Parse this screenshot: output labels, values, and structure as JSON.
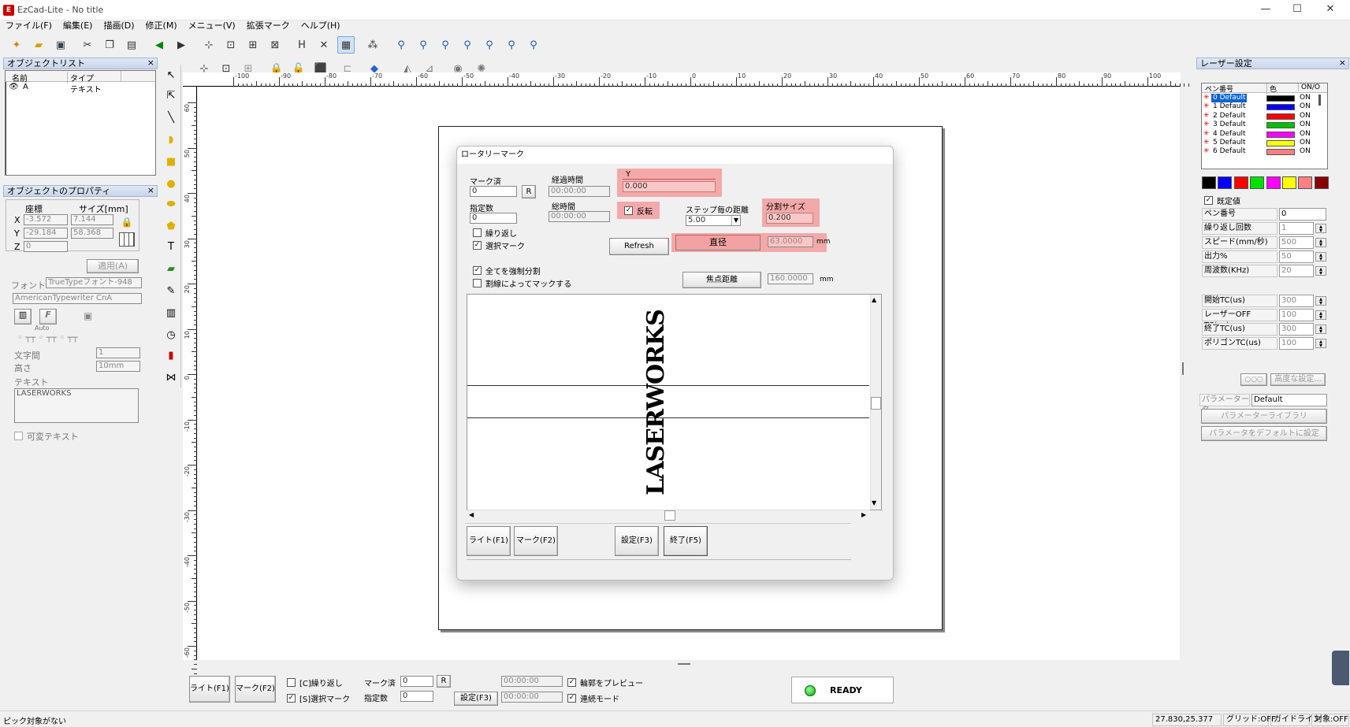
{
  "app": {
    "title": "EzCad-Lite  - No title",
    "icon": "ezcad-logo-icon"
  },
  "window_controls": {
    "minimize": "—",
    "maximize": "☐",
    "close": "✕"
  },
  "menu": [
    "ファイル(F)",
    "編集(E)",
    "描画(D)",
    "修正(M)",
    "メニュー(V)",
    "拡張マーク",
    "ヘルプ(H)"
  ],
  "object_list": {
    "title": "オブジェクトリスト",
    "col_name": "名前",
    "col_type": "タイプ",
    "rows": [
      {
        "name": "A",
        "type": "テキスト"
      }
    ]
  },
  "object_props": {
    "title": "オブジェクトのプロパティ",
    "coord_label": "座標",
    "size_label": "サイズ[mm]",
    "x_label": "X",
    "y_label": "Y",
    "z_label": "Z",
    "x_coord": "-3.572",
    "x_size": "7.144",
    "y_coord": "-29.184",
    "y_size": "58.368",
    "z_coord": "0",
    "apply_button": "適用(A)",
    "font_label": "フォント",
    "font_type": "TrueTypeフォント-948",
    "font_name": "AmericanTypewriter CnA",
    "f_button": "F",
    "auto_label": "Auto",
    "char_spacing_label": "文字間",
    "char_spacing_value": "1",
    "height_label": "高さ",
    "height_value": "10mm",
    "text_label": "テキスト",
    "text_value": "LASERWORKS",
    "variable_text_label": "可変テキスト"
  },
  "rulers": {
    "h_ticks": [
      "-100",
      "-90",
      "-80",
      "-70",
      "-60",
      "-50",
      "-40",
      "-30",
      "-20",
      "-10",
      "0",
      "10",
      "20",
      "30",
      "40",
      "50",
      "60",
      "70",
      "80",
      "90",
      "100"
    ],
    "v_ticks": [
      "60",
      "50",
      "40",
      "30",
      "20",
      "10",
      "0",
      "-10",
      "-20",
      "-30",
      "-40",
      "-50",
      "-60"
    ]
  },
  "rotary_dialog": {
    "title": "ロータリーマーク",
    "marked_label": "マーク済",
    "marked_value": "0",
    "r_button": "R",
    "specified_label": "指定数",
    "specified_value": "0",
    "elapsed_label": "経過時間",
    "elapsed_value": "00:00:00",
    "total_label": "総時間",
    "total_value": "00:00:00",
    "y_label": "Y",
    "y_value": "0.000",
    "invert_label": "反転",
    "step_label": "ステップ毎の距離",
    "step_value": "5.00",
    "split_label": "分割サイズ",
    "split_value": "0.200",
    "repeat_label": "繰り返し",
    "select_mark_label": "選択マーク",
    "refresh_button": "Refresh",
    "diameter_button": "直径",
    "diameter_value": "63.0000",
    "diameter_unit": "mm",
    "force_split_label": "全てを強制分割",
    "split_line_label": "割線によってマックする",
    "focus_button": "焦点距離",
    "focus_value": "160.0000",
    "focus_unit": "mm",
    "preview_text": "LASERWORKS",
    "light_button": "ライト(F1)",
    "mark_button": "マーク(F2)",
    "settings_button": "設定(F3)",
    "end_button": "終了(F5)"
  },
  "laser_settings": {
    "title": "レーザー設定",
    "col_pen": "ペン番号",
    "col_color": "色",
    "col_onoff": "ON/O",
    "pens": [
      {
        "name": "0 Default",
        "color": "#000000",
        "on": "ON"
      },
      {
        "name": "1 Default",
        "color": "#0000ff",
        "on": "ON"
      },
      {
        "name": "2 Default",
        "color": "#ff0000",
        "on": "ON"
      },
      {
        "name": "3 Default",
        "color": "#00c000",
        "on": "ON"
      },
      {
        "name": "4 Default",
        "color": "#ff00ff",
        "on": "ON"
      },
      {
        "name": "5 Default",
        "color": "#ffff00",
        "on": "ON"
      },
      {
        "name": "6 Default",
        "color": "#ff8080",
        "on": "ON"
      }
    ],
    "palette": [
      "#000000",
      "#0000ff",
      "#ff0000",
      "#00e000",
      "#ff00ff",
      "#ffff00",
      "#ff8080",
      "#8b0000"
    ],
    "default_label": "既定値",
    "params": [
      {
        "k": "ペン番号",
        "v": "0"
      },
      {
        "k": "繰り返し回数",
        "v": "1"
      },
      {
        "k": "スピード(mm/秒)",
        "v": "500"
      },
      {
        "k": "出力%",
        "v": "50"
      },
      {
        "k": "周波数(KHz)",
        "v": "20"
      },
      {
        "k": "開始TC(us)",
        "v": "300"
      },
      {
        "k": "レーザーOFF TC(us)",
        "v": "100"
      },
      {
        "k": "終了TC(us)",
        "v": "300"
      },
      {
        "k": "ポリゴンTC(us)",
        "v": "100"
      }
    ],
    "advanced_button": "高度な設定...",
    "param_name_label": "パラメーター名",
    "param_name_value": "Default",
    "library_button": "パラメーターライブラリ",
    "set_default_button": "パラメータをデフォルトに設定"
  },
  "bottom": {
    "light_button": "ライト(F1)",
    "mark_button": "マーク(F2)",
    "repeat_label": "[C]繰り返し",
    "select_mark_label": "[S]選択マーク",
    "marked_label": "マーク済",
    "marked_value": "0",
    "r_button": "R",
    "specified_label": "指定数",
    "specified_value": "0",
    "time1": "00:00:00",
    "time2": "00:00:00",
    "settings_button": "設定(F3)",
    "preview_outline_label": "輪郭をプレビュー",
    "continuous_label": "連続モード",
    "status": "READY"
  },
  "statusbar": {
    "left": "ピック対象がない",
    "coords": "27.830,25.377",
    "grid": "グリッド:OFF",
    "guide": "ガイドライン",
    "snap": "対象:OFF"
  }
}
